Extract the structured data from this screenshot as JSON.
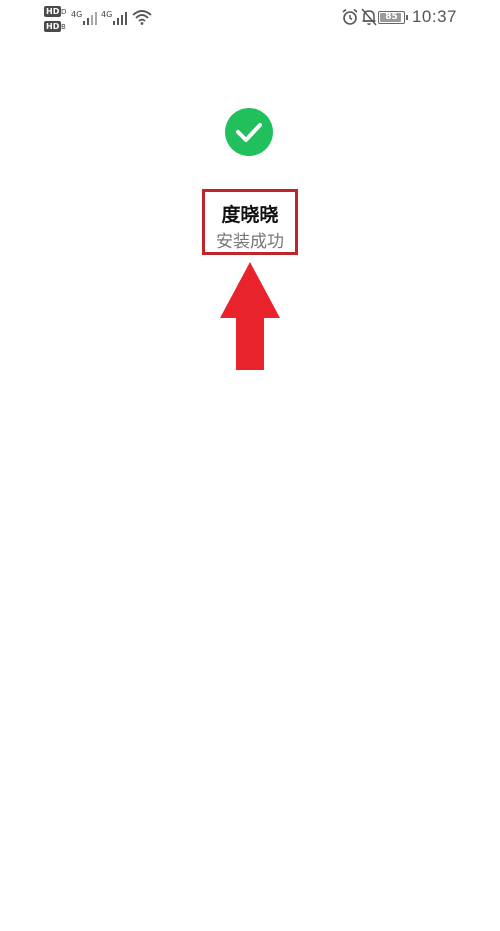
{
  "status_bar": {
    "hd_label_1": "HD",
    "hd_label_2": "HD",
    "hd_sub_1": "D",
    "hd_sub_2": "B",
    "network_1": "4G",
    "network_2": "4G",
    "battery_level": "85",
    "time": "10:37",
    "icons": [
      "signal-icon",
      "wifi-icon",
      "alarm-icon",
      "mute-icon",
      "battery-icon"
    ]
  },
  "content": {
    "status_icon": "check-circle-icon",
    "app_name": "度晓晓",
    "install_status": "安装成功"
  },
  "colors": {
    "success_green": "#20c05c",
    "annotation_red": "#e8232c",
    "highlight_border": "#c0242c"
  }
}
